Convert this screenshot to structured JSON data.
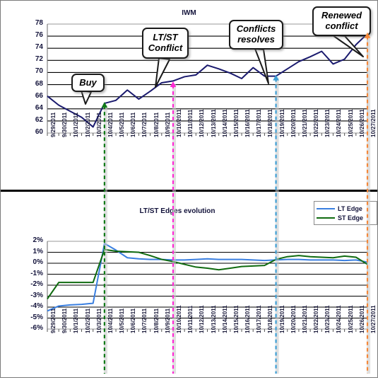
{
  "top": {
    "title": "IWM",
    "yticks": [
      "78",
      "76",
      "74",
      "72",
      "70",
      "68",
      "66",
      "64",
      "62",
      "60"
    ],
    "callouts": [
      {
        "id": "buy",
        "text": "Buy"
      },
      {
        "id": "ltst",
        "text": "LT/ST\nConflict"
      },
      {
        "id": "resolves",
        "text": "Conflicts\nresolves"
      },
      {
        "id": "renewed",
        "text": "Renewed\nconflict"
      }
    ]
  },
  "bottom": {
    "title": "LT/ST Edges evolution",
    "yticks": [
      "2%",
      "1%",
      "0%",
      "-1%",
      "-2%",
      "-3%",
      "-4%",
      "-5%",
      "-6%"
    ],
    "legend": [
      {
        "label": "LT Edge",
        "color": "#3a7fe0"
      },
      {
        "label": "ST Edge",
        "color": "#106b10"
      }
    ]
  },
  "xlabels": [
    "9/29/2011",
    "9/30/2011",
    "10/1/2011",
    "10/2/2011",
    "10/3/2011",
    "10/4/2011",
    "10/5/2011",
    "10/6/2011",
    "10/7/2011",
    "10/8/2011",
    "10/9/2011",
    "10/10/2011",
    "10/11/2011",
    "10/12/2011",
    "10/13/2011",
    "10/14/2011",
    "10/15/2011",
    "10/16/2011",
    "10/17/2011",
    "10/18/2011",
    "10/19/2011",
    "10/20/2011",
    "10/21/2011",
    "10/22/2011",
    "10/23/2011",
    "10/24/2011",
    "10/25/2011",
    "10/26/2011",
    "10/27/2011"
  ],
  "markers": [
    {
      "id": "buy-marker",
      "color": "#0f7a18",
      "date": "10/4/2011"
    },
    {
      "id": "ltst-marker",
      "color": "#ff2ad4",
      "date": "10/10/2011"
    },
    {
      "id": "resolves-marker",
      "color": "#3f9fd4",
      "date": "10/19/2011"
    },
    {
      "id": "renewed-marker",
      "color": "#f4883a",
      "date": "10/27/2011"
    }
  ],
  "colors": {
    "price_line": "#1a1a6e",
    "lt_edge": "#3a7fe0",
    "st_edge": "#106b10",
    "grid": "#000000",
    "frame": "#7a7a7a"
  },
  "chart_data": [
    {
      "type": "line",
      "title": "IWM",
      "xlabel": "",
      "ylabel": "",
      "ylim": [
        60,
        78
      ],
      "grid": true,
      "legend": "none",
      "x": [
        "9/29/2011",
        "9/30/2011",
        "10/1/2011",
        "10/2/2011",
        "10/3/2011",
        "10/4/2011",
        "10/5/2011",
        "10/6/2011",
        "10/7/2011",
        "10/8/2011",
        "10/9/2011",
        "10/10/2011",
        "10/11/2011",
        "10/12/2011",
        "10/13/2011",
        "10/14/2011",
        "10/15/2011",
        "10/16/2011",
        "10/17/2011",
        "10/18/2011",
        "10/19/2011",
        "10/20/2011",
        "10/21/2011",
        "10/22/2011",
        "10/23/2011",
        "10/24/2011",
        "10/25/2011",
        "10/26/2011",
        "10/27/2011"
      ],
      "series": [
        {
          "name": "IWM",
          "color": "#1a1a6e",
          "values": [
            66.1,
            64.6,
            63.6,
            62.6,
            61.0,
            64.9,
            65.4,
            67.1,
            65.6,
            66.9,
            68.3,
            68.6,
            69.3,
            69.6,
            71.2,
            70.6,
            69.9,
            69.0,
            70.8,
            69.4,
            69.4,
            70.6,
            71.8,
            72.6,
            73.5,
            71.4,
            72.2,
            74.6,
            76.4
          ]
        }
      ],
      "annotations": [
        {
          "text": "Buy",
          "points_to": "10/4/2011"
        },
        {
          "text": "LT/ST Conflict",
          "points_to": "10/10/2011"
        },
        {
          "text": "Conflicts resolves",
          "points_to": "10/19/2011"
        },
        {
          "text": "Renewed conflict",
          "points_to": "10/27/2011"
        }
      ]
    },
    {
      "type": "line",
      "title": "LT/ST Edges evolution",
      "xlabel": "",
      "ylabel": "",
      "ylim": [
        -6,
        2
      ],
      "grid": true,
      "legend": "top-right",
      "x": [
        "9/29/2011",
        "9/30/2011",
        "10/1/2011",
        "10/2/2011",
        "10/3/2011",
        "10/4/2011",
        "10/5/2011",
        "10/6/2011",
        "10/7/2011",
        "10/8/2011",
        "10/9/2011",
        "10/10/2011",
        "10/11/2011",
        "10/12/2011",
        "10/13/2011",
        "10/14/2011",
        "10/15/2011",
        "10/16/2011",
        "10/17/2011",
        "10/18/2011",
        "10/19/2011",
        "10/20/2011",
        "10/21/2011",
        "10/22/2011",
        "10/23/2011",
        "10/24/2011",
        "10/25/2011",
        "10/26/2011",
        "10/27/2011"
      ],
      "series": [
        {
          "name": "LT Edge",
          "color": "#3a7fe0",
          "values": [
            -4.35,
            -3.9,
            -3.8,
            -3.75,
            -3.65,
            1.8,
            1.2,
            0.5,
            0.4,
            0.35,
            0.35,
            0.3,
            0.3,
            0.35,
            0.4,
            0.35,
            0.35,
            0.35,
            0.3,
            0.25,
            0.3,
            0.35,
            0.35,
            0.3,
            0.3,
            0.3,
            0.25,
            0.3,
            0.1
          ]
        },
        {
          "name": "ST Edge",
          "color": "#106b10",
          "values": [
            -3.25,
            -1.75,
            -1.75,
            -1.75,
            -1.75,
            1.25,
            1.1,
            1.05,
            1.0,
            0.7,
            0.35,
            0.15,
            -0.1,
            -0.35,
            -0.45,
            -0.6,
            -0.45,
            -0.3,
            -0.25,
            -0.2,
            0.35,
            0.6,
            0.7,
            0.6,
            0.55,
            0.5,
            0.65,
            0.55,
            -0.1
          ]
        }
      ]
    }
  ]
}
